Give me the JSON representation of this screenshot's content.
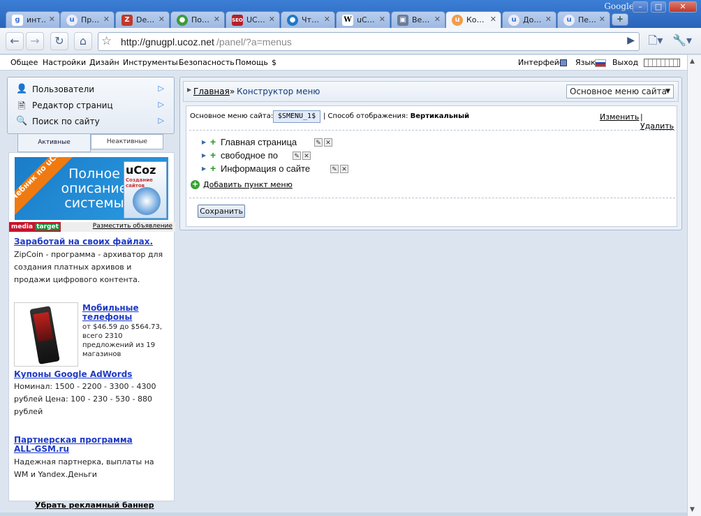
{
  "browser": {
    "brand": "Google",
    "tabs": [
      {
        "label": "инт…",
        "icon": "google-icon",
        "active": false
      },
      {
        "label": "Пр…",
        "icon": "ucoz-icon",
        "active": false
      },
      {
        "label": "De…",
        "icon": "z-icon",
        "active": false
      },
      {
        "label": "По…",
        "icon": "globe-icon",
        "active": false
      },
      {
        "label": "UC…",
        "icon": "seo-icon",
        "active": false
      },
      {
        "label": "Чт…",
        "icon": "chat-icon",
        "active": false
      },
      {
        "label": "uC…",
        "icon": "wikipedia-icon",
        "active": false
      },
      {
        "label": "Ве…",
        "icon": "photo-icon",
        "active": false
      },
      {
        "label": "Ко…",
        "icon": "ucoz-icon",
        "active": true
      },
      {
        "label": "До…",
        "icon": "ucoz-icon",
        "active": false
      },
      {
        "label": "Пе…",
        "icon": "ucoz-icon",
        "active": false
      }
    ],
    "url_host": "http://gnugpl.ucoz.net",
    "url_path": "/panel/?a=menus"
  },
  "site_menu": {
    "items": [
      "Общее",
      "Настройки",
      "Дизайн",
      "Инструменты",
      "Безопасность",
      "Помощь",
      "$"
    ],
    "interface_label": "Интерфейс",
    "language_label": "Язык",
    "logout_label": "Выход"
  },
  "sidebar": {
    "quick_items": [
      {
        "label": "Пользователи",
        "icon": "users-icon"
      },
      {
        "label": "Редактор страниц",
        "icon": "page-editor-icon"
      },
      {
        "label": "Поиск по сайту",
        "icon": "search-icon"
      }
    ],
    "tab_active": "Активные",
    "tab_inactive": "Неактивные"
  },
  "ads": {
    "banner_ribbon": "Учебник по uCoz",
    "banner_text": "Полное описание системы",
    "book_title": "uCoz",
    "book_subtitle": "Создание сайтов",
    "media_target_a": "media",
    "media_target_b": "target",
    "place_ad": "Разместить объявление",
    "ad1_title": "Заработай на своих файлах.",
    "ad1_text": "ZipCoin - программа - архиватор для создания платных архивов и продажи цифрового контента.",
    "ad2_title": "Мобильные телефоны",
    "ad2_text": "от $46.59 до $564.73, всего 2310 предложений из 19 магазинов",
    "ad3_title": "Купоны Google AdWords",
    "ad3_text": "Номинал: 1500 - 2200 - 3300 - 4300 рублей Цена: 100 - 230 - 530 - 880 рублей",
    "ad4_title": "Партнерская программа ALL-GSM.ru",
    "ad4_text": "Надежная партнерка, выплаты на WM и Yandex.Деньги",
    "remove_banner": "Убрать рекламный баннер"
  },
  "main": {
    "breadcrumb_home": "Главная",
    "breadcrumb_sep": "»",
    "breadcrumb_current": "Конструктор меню",
    "menu_select": "Основное меню сайта",
    "info_label": "Основное меню сайта:",
    "menu_code": "$SMENU_1$",
    "display_label": "| Способ отображения:",
    "display_value": "Вертикальный",
    "edit_link": "Изменить",
    "delete_sep": "|",
    "delete_link": "Удалить",
    "items": [
      {
        "label": "Главная страница"
      },
      {
        "label": "свободное по"
      },
      {
        "label": "Информация о сайте"
      }
    ],
    "add_item": "Добавить пункт меню",
    "save_button": "Сохранить"
  }
}
